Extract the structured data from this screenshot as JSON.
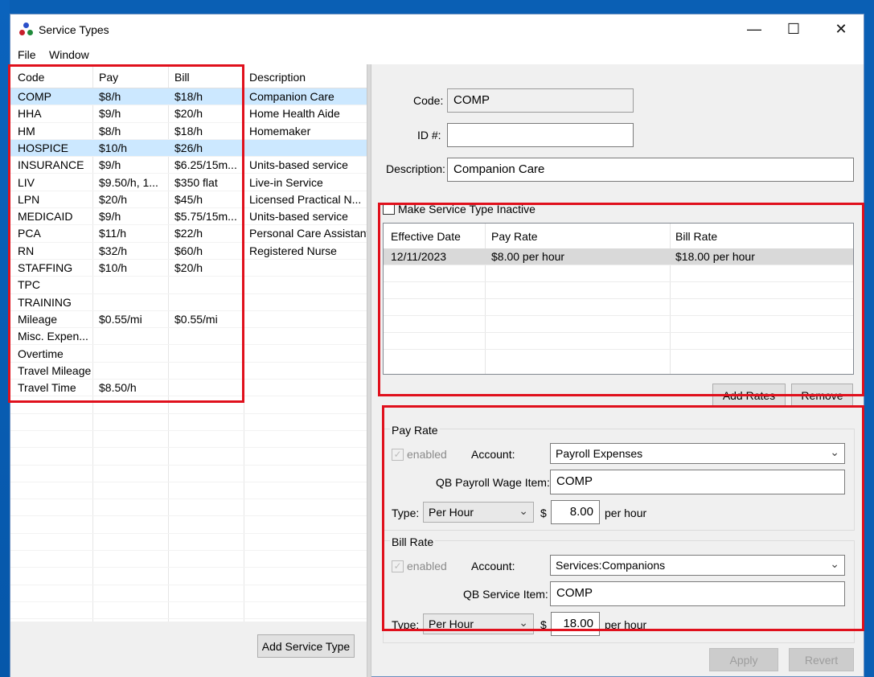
{
  "window": {
    "title": "Service Types",
    "minimize": "—",
    "maximize": "☐",
    "close": "✕"
  },
  "menu": [
    "File",
    "Window"
  ],
  "service_grid": {
    "headers": [
      "Code",
      "Pay",
      "Bill",
      "Description"
    ],
    "rows": [
      {
        "code": "COMP",
        "pay": "$8/h",
        "bill": "$18/h",
        "desc": "Companion Care"
      },
      {
        "code": "HHA",
        "pay": "$9/h",
        "bill": "$20/h",
        "desc": "Home Health Aide"
      },
      {
        "code": "HM",
        "pay": "$8/h",
        "bill": "$18/h",
        "desc": "Homemaker"
      },
      {
        "code": "HOSPICE",
        "pay": "$10/h",
        "bill": "$26/h",
        "desc": ""
      },
      {
        "code": "INSURANCE",
        "pay": "$9/h",
        "bill": "$6.25/15m...",
        "desc": "Units-based service"
      },
      {
        "code": "LIV",
        "pay": "$9.50/h, 1...",
        "bill": "$350 flat",
        "desc": "Live-in Service"
      },
      {
        "code": "LPN",
        "pay": "$20/h",
        "bill": "$45/h",
        "desc": "Licensed Practical N..."
      },
      {
        "code": "MEDICAID",
        "pay": "$9/h",
        "bill": "$5.75/15m...",
        "desc": "Units-based service"
      },
      {
        "code": "PCA",
        "pay": "$11/h",
        "bill": "$22/h",
        "desc": "Personal Care Assistant"
      },
      {
        "code": "RN",
        "pay": "$32/h",
        "bill": "$60/h",
        "desc": "Registered Nurse"
      },
      {
        "code": "STAFFING",
        "pay": "$10/h",
        "bill": "$20/h",
        "desc": ""
      },
      {
        "code": "TPC",
        "pay": "",
        "bill": "",
        "desc": ""
      },
      {
        "code": "TRAINING",
        "pay": "",
        "bill": "",
        "desc": ""
      },
      {
        "code": "Mileage",
        "pay": "$0.55/mi",
        "bill": "$0.55/mi",
        "desc": ""
      },
      {
        "code": "Misc. Expen...",
        "pay": "",
        "bill": "",
        "desc": ""
      },
      {
        "code": "Overtime",
        "pay": "",
        "bill": "",
        "desc": ""
      },
      {
        "code": "Travel Mileage",
        "pay": "",
        "bill": "",
        "desc": ""
      },
      {
        "code": "Travel Time",
        "pay": "$8.50/h",
        "bill": "",
        "desc": ""
      }
    ],
    "add_button": "Add Service Type"
  },
  "detail": {
    "code_label": "Code:",
    "code_value": "COMP",
    "id_label": "ID #:",
    "id_value": "",
    "description_label": "Description:",
    "description_value": "Companion Care",
    "inactive_label": "Make Service Type Inactive"
  },
  "rates": {
    "headers": [
      "Effective Date",
      "Pay Rate",
      "Bill Rate"
    ],
    "rows": [
      {
        "date": "12/11/2023",
        "pay": "$8.00 per hour",
        "bill": "$18.00 per hour"
      }
    ],
    "add_button": "Add Rates",
    "remove_button": "Remove"
  },
  "pay_rate": {
    "group_title": "Pay Rate",
    "enabled_label": "enabled",
    "account_label": "Account:",
    "account_value": "Payroll Expenses",
    "item_label": "QB Payroll Wage Item:",
    "item_value": "COMP",
    "type_label": "Type:",
    "type_value": "Per Hour",
    "currency": "$",
    "amount": "8.00",
    "unit": "per hour"
  },
  "bill_rate": {
    "group_title": "Bill Rate",
    "enabled_label": "enabled",
    "account_label": "Account:",
    "account_value": "Services:Companions",
    "item_label": "QB Service Item:",
    "item_value": "COMP",
    "type_label": "Type:",
    "type_value": "Per Hour",
    "currency": "$",
    "amount": "18.00",
    "unit": "per hour"
  },
  "footer": {
    "apply": "Apply",
    "revert": "Revert"
  },
  "colors": {
    "highlight_box": "#e0101c",
    "selected_row": "#cce8ff",
    "desktop": "#0a5fb4"
  }
}
